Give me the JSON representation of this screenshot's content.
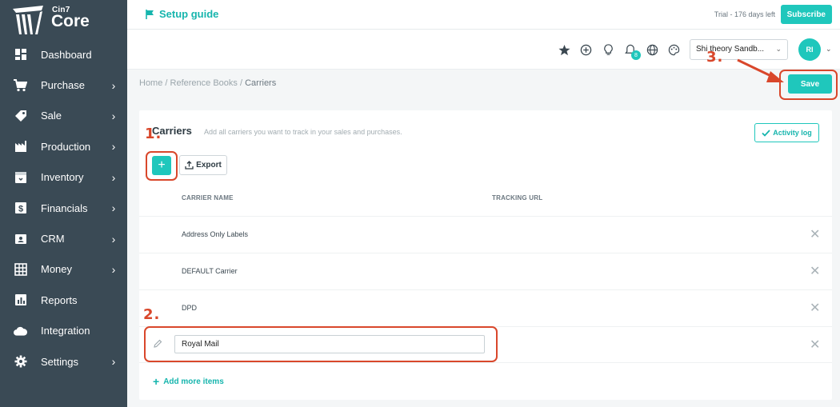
{
  "brand": {
    "small": "Cin7",
    "name": "Core"
  },
  "sidebar": {
    "items": [
      {
        "label": "Dashboard",
        "icon": "dashboard-icon",
        "has_children": false
      },
      {
        "label": "Purchase",
        "icon": "cart-icon",
        "has_children": true
      },
      {
        "label": "Sale",
        "icon": "tag-icon",
        "has_children": true
      },
      {
        "label": "Production",
        "icon": "factory-icon",
        "has_children": true
      },
      {
        "label": "Inventory",
        "icon": "box-icon",
        "has_children": true
      },
      {
        "label": "Financials",
        "icon": "dollar-icon",
        "has_children": true
      },
      {
        "label": "CRM",
        "icon": "contact-card-icon",
        "has_children": true
      },
      {
        "label": "Money",
        "icon": "grid-icon",
        "has_children": true
      },
      {
        "label": "Reports",
        "icon": "bar-chart-icon",
        "has_children": false
      },
      {
        "label": "Integration",
        "icon": "cloud-icon",
        "has_children": false
      },
      {
        "label": "Settings",
        "icon": "gear-icon",
        "has_children": true
      }
    ],
    "chevron": "›"
  },
  "topbar": {
    "setup_label": "Setup guide",
    "trial_text": "Trial - 176 days left",
    "subscribe_label": "Subscribe"
  },
  "header": {
    "notification_count": "8",
    "company_name": "Shi theory Sandb...",
    "avatar_initials": "RI"
  },
  "breadcrumb": {
    "home": "Home",
    "reference_books": "Reference Books",
    "current": "Carriers",
    "separator": "/"
  },
  "save_label": "Save",
  "panel": {
    "title": "Carriers",
    "subtitle": "Add all carriers you want to track in your sales and purchases.",
    "activity_label": "Activity log",
    "add_label": "+",
    "export_label": "Export",
    "columns": [
      "CARRIER NAME",
      "TRACKING URL"
    ],
    "rows": [
      {
        "name": "Address Only Labels"
      },
      {
        "name": "DEFAULT Carrier"
      },
      {
        "name": "DPD"
      }
    ],
    "editing_row": {
      "value": "Royal Mail"
    },
    "add_more_label": "Add more items",
    "delete_glyph": "✕"
  },
  "annotations": {
    "one": "1.",
    "two": "2.",
    "three": "3.",
    "color": "#d9472b"
  },
  "colors": {
    "sidebar": "#3a4a55",
    "accent": "#1fc7bc"
  }
}
